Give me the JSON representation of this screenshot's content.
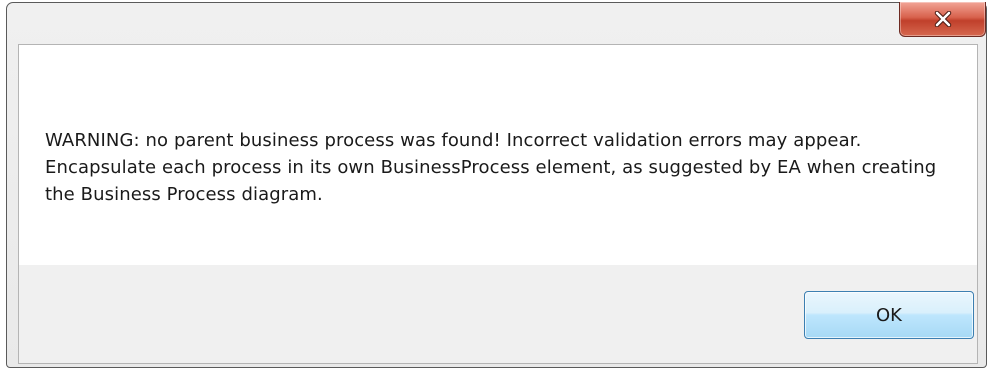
{
  "dialog": {
    "close_icon": "close-x-icon",
    "message": "WARNING: no parent business process was found! Incorrect validation errors may appear. Encapsulate each process in its own BusinessProcess element, as suggested by EA when creating the Business Process diagram.",
    "ok_label": "OK"
  },
  "colors": {
    "close_button": "#c94a35",
    "ok_button_border": "#3c7fb1",
    "ok_button_fill": "#d9f0fc",
    "content_background": "#ffffff",
    "footer_background": "#f0f0f0"
  }
}
